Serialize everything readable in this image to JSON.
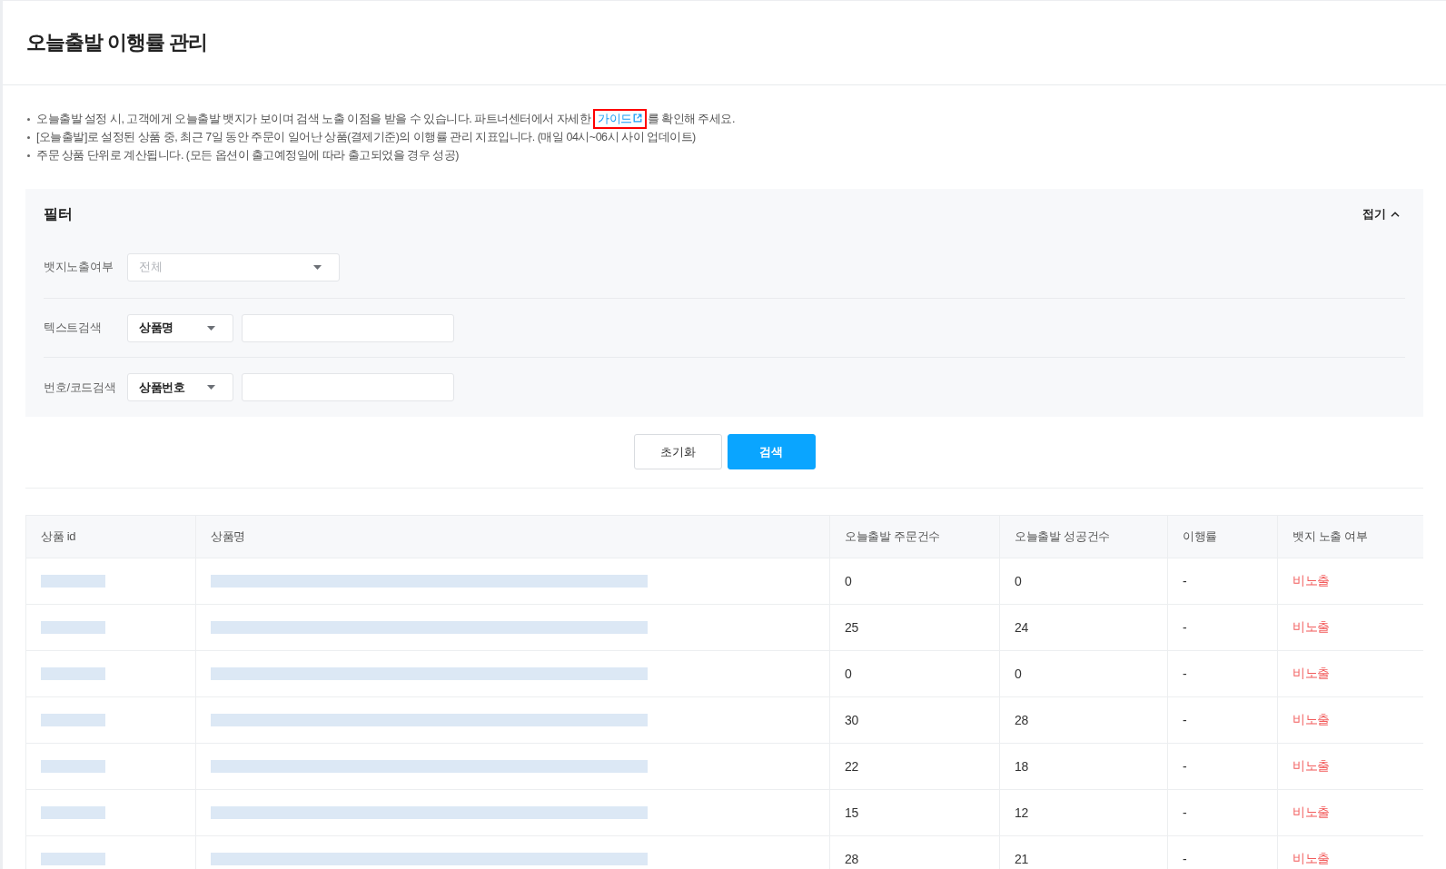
{
  "page": {
    "title": "오늘출발 이행률 관리"
  },
  "notes": [
    {
      "parts": [
        {
          "kind": "text",
          "text": "오늘출발 설정 시, 고객에게 오늘출발 뱃지가 보이며 검색 노출 이점을 받을 수 있습니다. 파트너센터에서 자세한 "
        },
        {
          "kind": "link",
          "text": "가이드",
          "external": true,
          "highlighted": true
        },
        {
          "kind": "text",
          "text": "를 확인해 주세요."
        }
      ]
    },
    {
      "parts": [
        {
          "kind": "text",
          "text": "[오늘출발]로 설정된 상품 중, 최근 7일 동안 주문이 일어난 상품(결제기준)의 이행률 관리 지표입니다. (매일 04시~06시 사이 업데이트)"
        }
      ]
    },
    {
      "parts": [
        {
          "kind": "text",
          "text": "주문 상품 단위로 계산됩니다. (모든 옵션이 출고예정일에 따라 출고되었을 경우 성공)"
        }
      ]
    }
  ],
  "filter": {
    "title": "필터",
    "toggle_label": "접기",
    "expanded": true,
    "rows": [
      {
        "kind": "select",
        "label": "뱃지노출여부",
        "select": {
          "placeholder": "전체"
        }
      },
      {
        "kind": "select_text",
        "label": "텍스트검색",
        "select": {
          "value": "상품명"
        }
      },
      {
        "kind": "select_text",
        "label": "번호/코드검색",
        "select": {
          "value": "상품번호"
        }
      }
    ]
  },
  "actions": [
    {
      "label": "초기화",
      "kind": "secondary"
    },
    {
      "label": "검색",
      "kind": "primary"
    }
  ],
  "table": {
    "columns": [
      "상품 id",
      "상품명",
      "오늘출발 주문건수",
      "오늘출발 성공건수",
      "이행률",
      "뱃지 노출 여부"
    ],
    "rows": [
      {
        "product_id": {
          "redacted": true
        },
        "product_name": {
          "redacted": true
        },
        "order_count": "0",
        "success_count": "0",
        "rate": "-",
        "badge_status": {
          "text": "비노출",
          "exposed": false
        }
      },
      {
        "product_id": {
          "redacted": true
        },
        "product_name": {
          "redacted": true
        },
        "order_count": "25",
        "success_count": "24",
        "rate": "-",
        "badge_status": {
          "text": "비노출",
          "exposed": false
        }
      },
      {
        "product_id": {
          "redacted": true
        },
        "product_name": {
          "redacted": true
        },
        "order_count": "0",
        "success_count": "0",
        "rate": "-",
        "badge_status": {
          "text": "비노출",
          "exposed": false
        }
      },
      {
        "product_id": {
          "redacted": true
        },
        "product_name": {
          "redacted": true
        },
        "order_count": "30",
        "success_count": "28",
        "rate": "-",
        "badge_status": {
          "text": "비노출",
          "exposed": false
        }
      },
      {
        "product_id": {
          "redacted": true
        },
        "product_name": {
          "redacted": true
        },
        "order_count": "22",
        "success_count": "18",
        "rate": "-",
        "badge_status": {
          "text": "비노출",
          "exposed": false
        }
      },
      {
        "product_id": {
          "redacted": true
        },
        "product_name": {
          "redacted": true
        },
        "order_count": "15",
        "success_count": "12",
        "rate": "-",
        "badge_status": {
          "text": "비노출",
          "exposed": false
        }
      },
      {
        "product_id": {
          "redacted": true
        },
        "product_name": {
          "redacted": true
        },
        "order_count": "28",
        "success_count": "21",
        "rate": "-",
        "badge_status": {
          "text": "비노출",
          "exposed": false
        }
      }
    ]
  }
}
